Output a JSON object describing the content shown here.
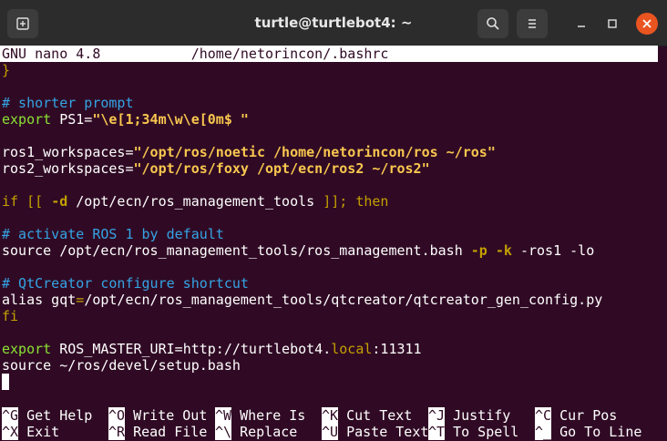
{
  "window": {
    "title": "turtle@turtlebot4: ~"
  },
  "nano": {
    "version": "GNU nano 4.8",
    "file": "/home/netorincon/.bashrc"
  },
  "editor": {
    "l_brace": "}",
    "cmt1": "# shorter prompt",
    "export_kw": "export",
    "ps1_var": " PS1=",
    "ps1_val": "\"\\e[1;34m\\w\\e[0m$ \"",
    "ros1_var": "ros1_workspaces=",
    "ros1_val": "\"/opt/ros/noetic /home/netorincon/ros ~/ros\"",
    "ros2_var": "ros2_workspaces=",
    "ros2_val": "\"/opt/ros/foxy /opt/ecn/ros2 ~/ros2\"",
    "if_a": "if [[ ",
    "if_flag": "-d",
    "if_path": " /opt/ecn/ros_management_tools ",
    "if_b": "]]; then",
    "cmt2": "# activate ROS 1 by default",
    "src1_a": "source /opt/ecn/ros_management_tools/ros_management.bash ",
    "src1_p": "-p",
    "src1_k": "-k",
    "src1_rest": " -ros1 -lo",
    "cmt3": "# QtCreator configure shortcut",
    "alias_a": "alias gqt",
    "alias_eq": "=",
    "alias_b": "/opt/ecn/ros_management_tools/qtcreator/qtcreator_gen_config.py",
    "fi": "fi",
    "export_kw2": "export",
    "master_var": " ROS_MASTER_URI=",
    "master_a": "http://turtlebot4.",
    "master_local": "local",
    "master_port": ":11311",
    "src2": "source ~/ros/devel/setup.bash"
  },
  "shortcuts": [
    {
      "key": "^G",
      "label": " Get Help"
    },
    {
      "key": "^O",
      "label": " Write Out"
    },
    {
      "key": "^W",
      "label": " Where Is"
    },
    {
      "key": "^K",
      "label": " Cut Text"
    },
    {
      "key": "^J",
      "label": " Justify"
    },
    {
      "key": "^C",
      "label": " Cur Pos"
    },
    {
      "key": "^X",
      "label": " Exit"
    },
    {
      "key": "^R",
      "label": " Read File"
    },
    {
      "key": "^\\",
      "label": " Replace"
    },
    {
      "key": "^U",
      "label": " Paste Text"
    },
    {
      "key": "^T",
      "label": " To Spell"
    },
    {
      "key": "^_",
      "label": " Go To Line"
    }
  ],
  "colors": {
    "terminal_bg": "#300a24",
    "close_btn": "#e95420"
  }
}
